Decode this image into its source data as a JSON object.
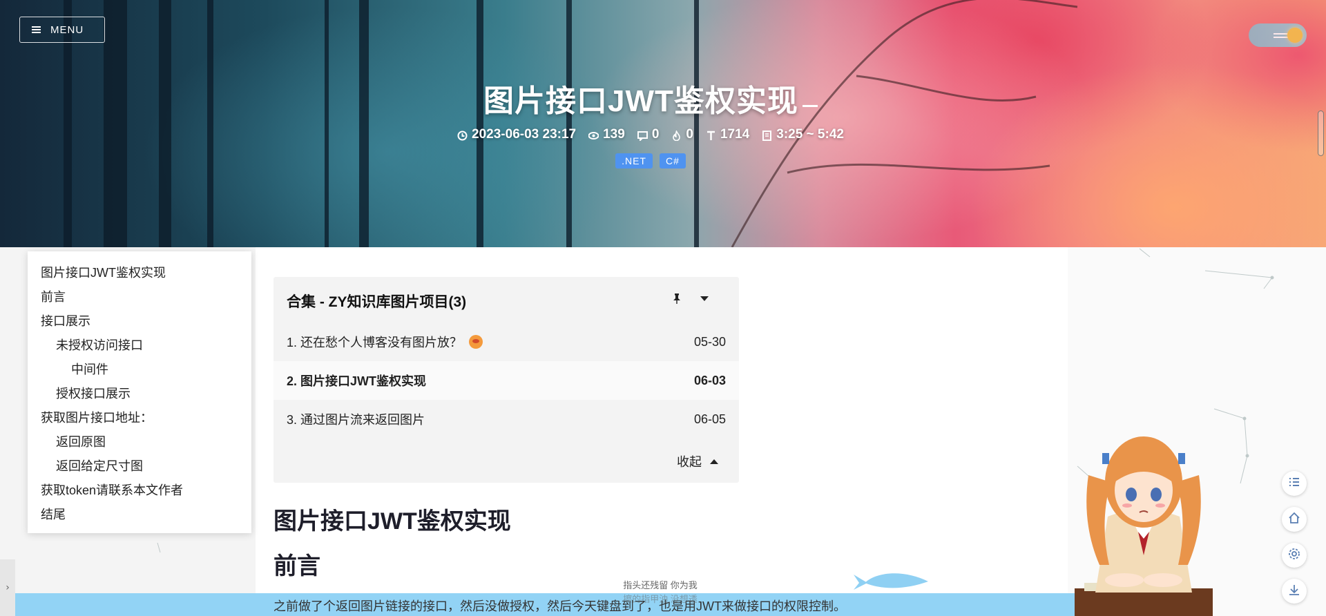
{
  "header": {
    "menu_label": "MENU",
    "title": "图片接口JWT鉴权实现",
    "meta": {
      "date": "2023-06-03 23:17",
      "views": "139",
      "comments": "0",
      "likes": "0",
      "words": "1714",
      "read_time": "3:25 ~ 5:42"
    },
    "tags": [
      ".NET",
      "C#"
    ]
  },
  "toc": [
    {
      "label": "图片接口JWT鉴权实现",
      "level": 1
    },
    {
      "label": "前言",
      "level": 1
    },
    {
      "label": "接口展示",
      "level": 1
    },
    {
      "label": "未授权访问接口",
      "level": 2
    },
    {
      "label": "中间件",
      "level": 3
    },
    {
      "label": "授权接口展示",
      "level": 2
    },
    {
      "label": "获取图片接口地址：",
      "level": 1
    },
    {
      "label": "返回原图",
      "level": 2
    },
    {
      "label": "返回给定尺寸图",
      "level": 2
    },
    {
      "label": "获取token请联系本文作者",
      "level": 1
    },
    {
      "label": "结尾",
      "level": 1
    }
  ],
  "series": {
    "title": "合集 - ZY知识库图片项目(3)",
    "items": [
      {
        "title": "1. 还在愁个人博客没有图片放？",
        "date": "05-30",
        "active": false
      },
      {
        "title": "2. 图片接口JWT鉴权实现",
        "date": "06-03",
        "active": true
      },
      {
        "title": "3. 通过图片流来返回图片",
        "date": "06-05",
        "active": false
      }
    ],
    "collapse_label": "收起"
  },
  "article": {
    "h1": "图片接口JWT鉴权实现",
    "h2": "前言",
    "paragraph": "之前做了个返回图片链接的接口，然后没做授权，然后今天键盘到了，也是用JWT来做接口的权限控制。"
  },
  "footer_caption": {
    "line1": "指头还残留 你为我",
    "line2": "擦的指甲油 没想透"
  },
  "float_buttons": [
    "toc-icon",
    "home-icon",
    "settings-icon",
    "download-icon"
  ],
  "colors": {
    "tag_bg": "#4f93f0",
    "wave": "#92d3f5"
  }
}
